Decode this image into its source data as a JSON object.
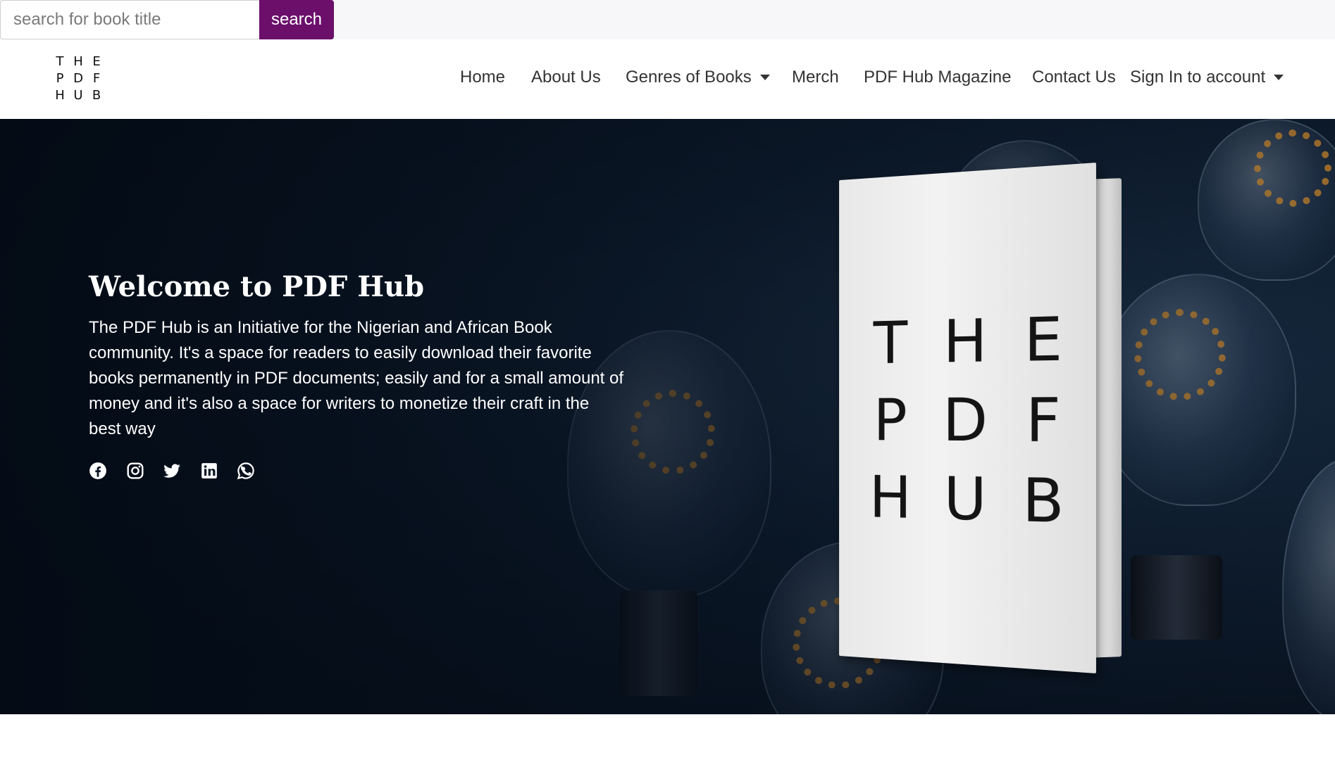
{
  "search": {
    "placeholder": "search for book title",
    "value": "",
    "button_label": "search",
    "button_color": "#6b0f6b"
  },
  "logo": {
    "rows": [
      [
        "T",
        "H",
        "E"
      ],
      [
        "P",
        "D",
        "F"
      ],
      [
        "H",
        "U",
        "B"
      ]
    ]
  },
  "nav": {
    "items": [
      {
        "label": "Home",
        "dropdown": false
      },
      {
        "label": "About Us",
        "dropdown": false
      },
      {
        "label": "Genres of Books",
        "dropdown": true
      },
      {
        "label": "Merch",
        "dropdown": false
      },
      {
        "label": "PDF Hub Magazine",
        "dropdown": false
      },
      {
        "label": "Contact Us",
        "dropdown": false
      },
      {
        "label": "Sign In to account",
        "dropdown": true
      }
    ]
  },
  "hero": {
    "title": "Welcome to PDF Hub",
    "description": "The PDF Hub is an Initiative for the Nigerian and African Book community. It's a space for readers to easily download their favorite books permanently in PDF documents; easily and for a small amount of money and it's also a space for writers to monetize their craft in the best way",
    "social_icons": [
      "facebook-icon",
      "instagram-icon",
      "twitter-icon",
      "linkedin-icon",
      "whatsapp-icon"
    ]
  },
  "book": {
    "cover_rows": [
      [
        "T",
        "H",
        "E"
      ],
      [
        "P",
        "D",
        "F"
      ],
      [
        "H",
        "U",
        "B"
      ]
    ]
  }
}
